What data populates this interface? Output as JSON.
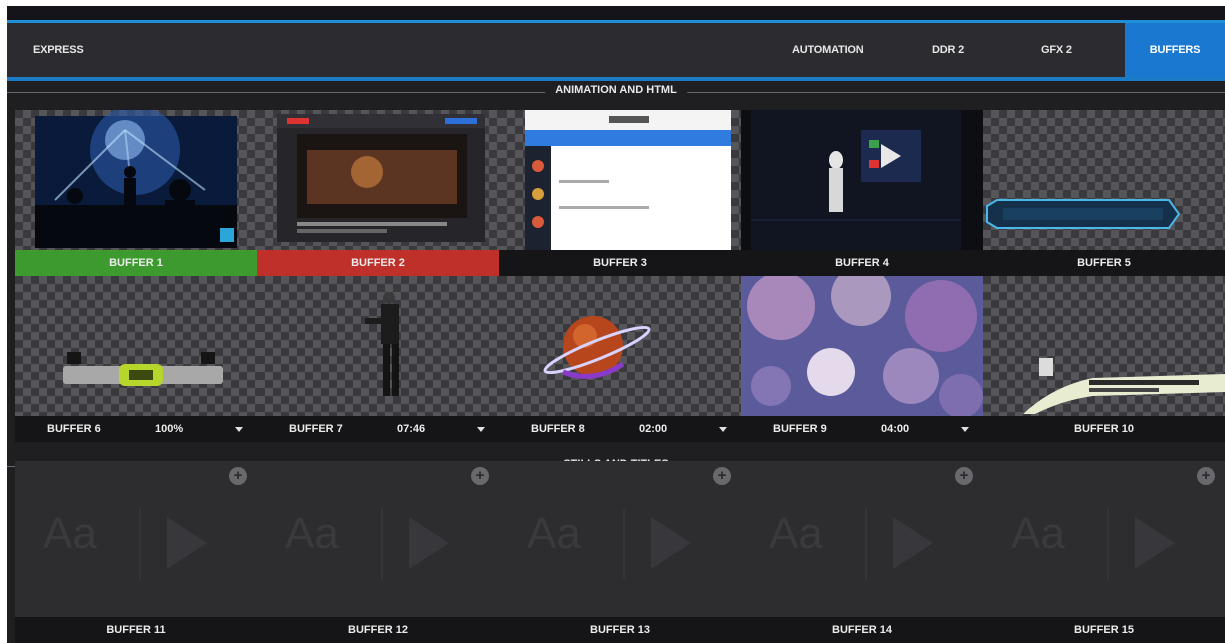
{
  "tabs": {
    "express": "EXPRESS",
    "automation": "AUTOMATION",
    "ddr2": "DDR 2",
    "gfx2": "GFX 2",
    "buffers": "BUFFERS"
  },
  "sections": {
    "animation": "ANIMATION AND HTML",
    "stills": "STILLS AND TITLES"
  },
  "buffers_row1": [
    {
      "name": "BUFFER 1",
      "state": "green"
    },
    {
      "name": "BUFFER 2",
      "state": "red"
    },
    {
      "name": "BUFFER 3",
      "state": "normal"
    },
    {
      "name": "BUFFER 4",
      "state": "normal"
    },
    {
      "name": "BUFFER 5",
      "state": "normal"
    }
  ],
  "buffers_row2": [
    {
      "name": "BUFFER 6",
      "value": "100%"
    },
    {
      "name": "BUFFER 7",
      "value": "07:46"
    },
    {
      "name": "BUFFER 8",
      "value": "02:00"
    },
    {
      "name": "BUFFER 9",
      "value": "04:00"
    },
    {
      "name": "BUFFER 10",
      "value": ""
    }
  ],
  "stills": [
    {
      "name": "BUFFER 11"
    },
    {
      "name": "BUFFER 12"
    },
    {
      "name": "BUFFER 13"
    },
    {
      "name": "BUFFER 14"
    },
    {
      "name": "BUFFER 15"
    }
  ],
  "still_placeholder": "Aa",
  "colors": {
    "accent_blue": "#1b78d0",
    "active_green": "#3d9a2f",
    "active_red": "#c0302b"
  }
}
